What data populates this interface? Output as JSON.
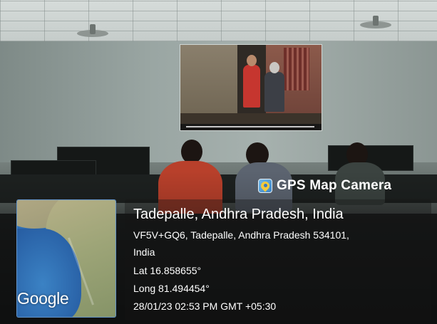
{
  "brand": {
    "name": "GPS Map Camera",
    "icon": "gps-map-camera-icon"
  },
  "map": {
    "provider_label": "Google"
  },
  "location": {
    "title": "Tadepalle, Andhra Pradesh, India",
    "address_line1": "VF5V+GQ6, Tadepalle, Andhra Pradesh 534101,",
    "address_line2": "India",
    "latitude": "Lat 16.858655°",
    "longitude": "Long 81.494454°",
    "timestamp": "28/01/23 02:53 PM GMT +05:30"
  },
  "colors": {
    "overlay_text": "#ffffff",
    "map_water": "#2e6fb6",
    "map_land": "#9ea578"
  }
}
